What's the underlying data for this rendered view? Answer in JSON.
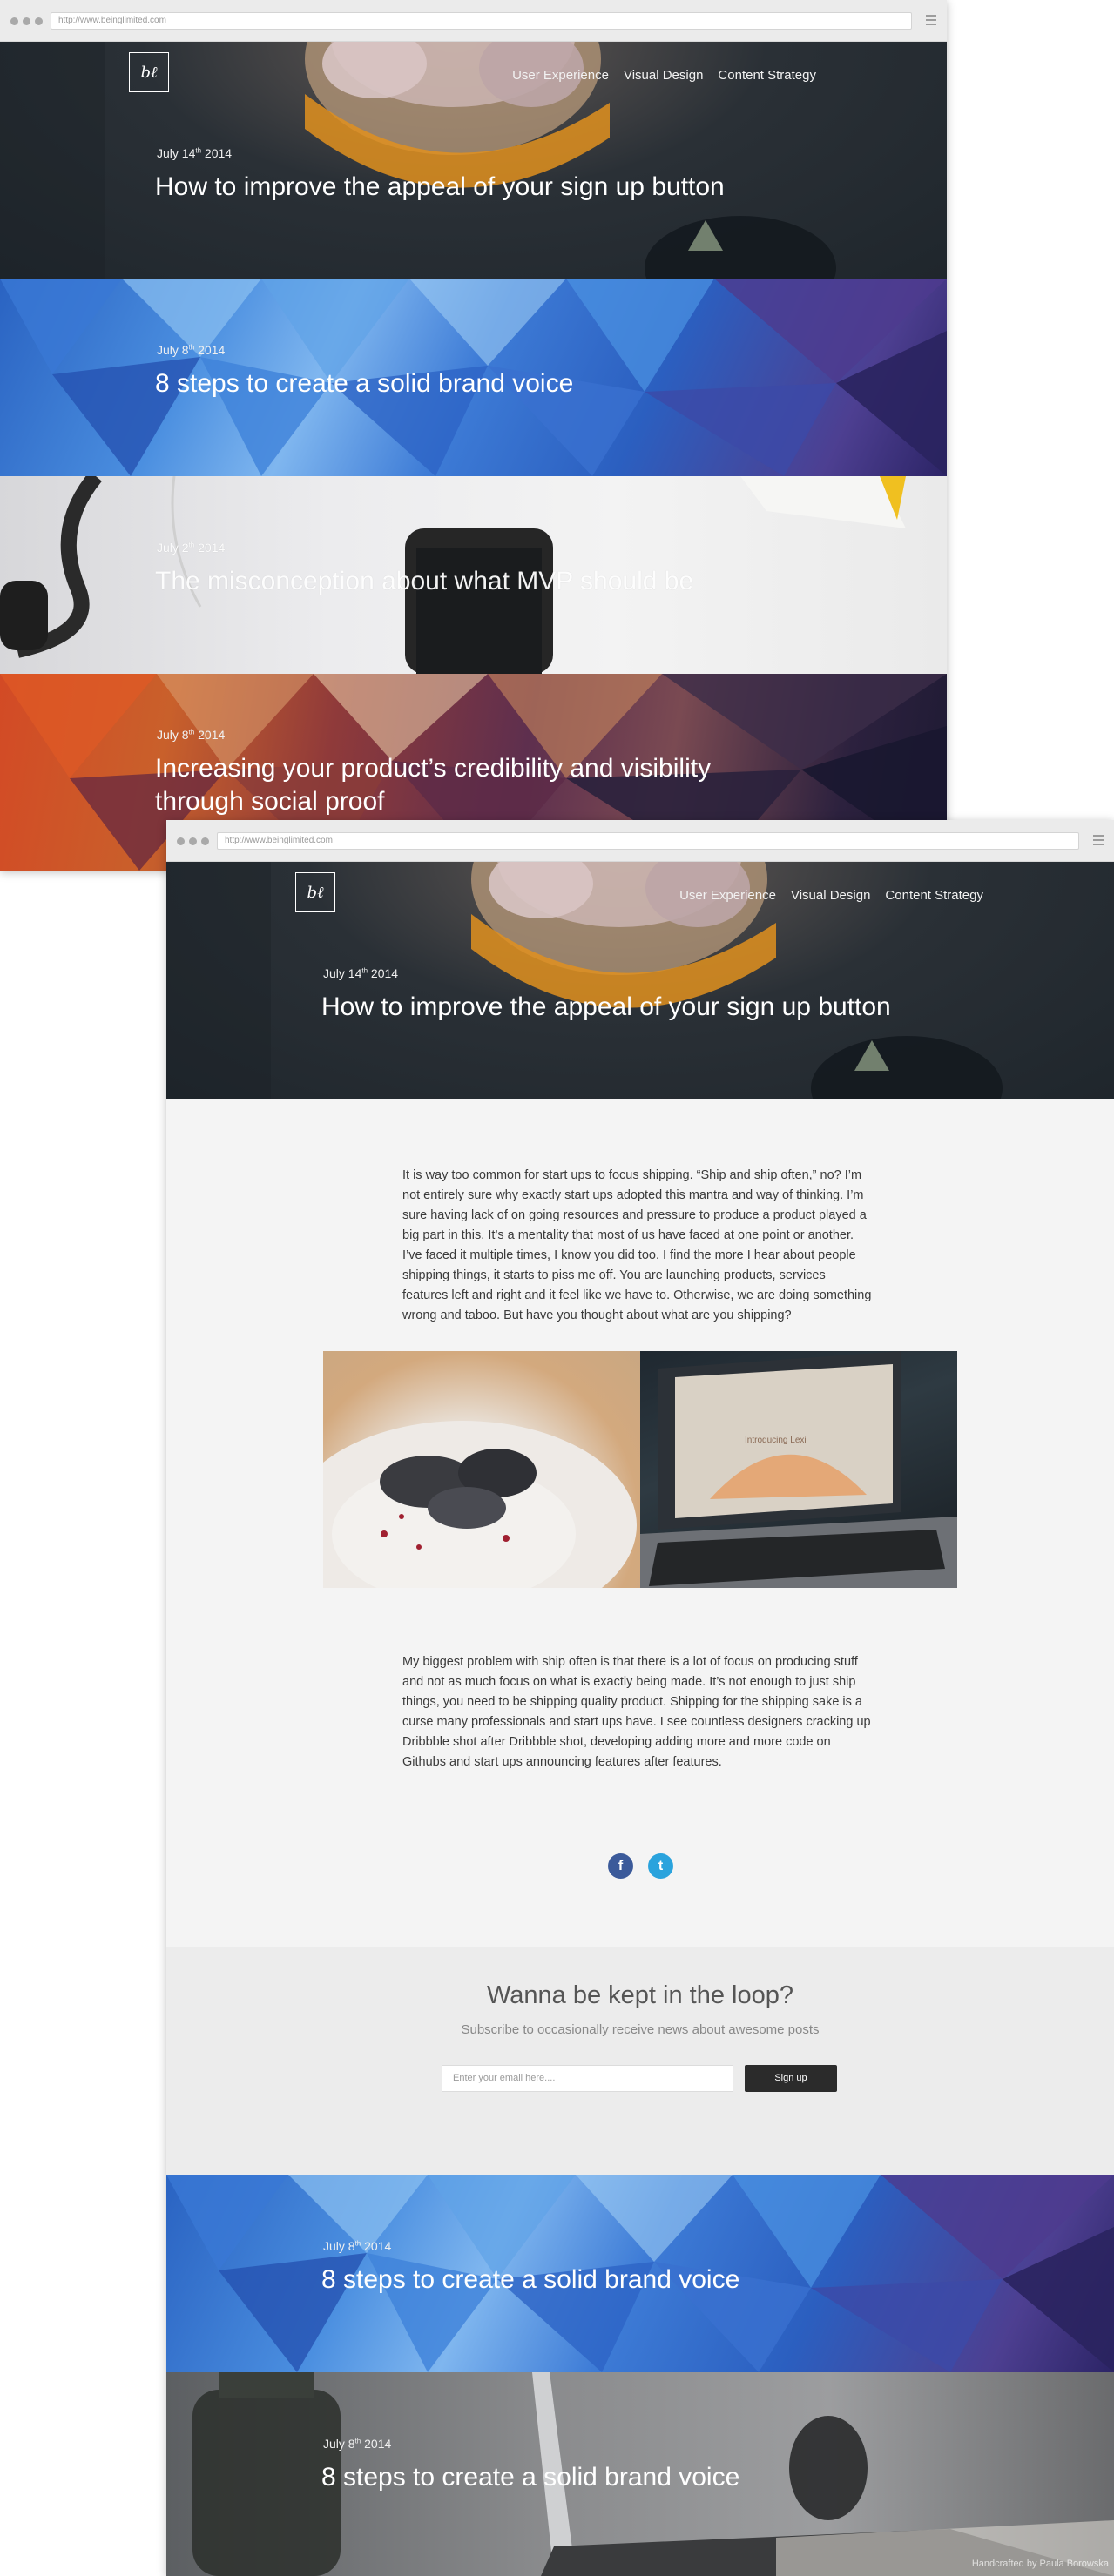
{
  "browser": {
    "url": "http://www.beinglimited.com"
  },
  "site": {
    "logo_text": "bℓ",
    "nav": [
      "User Experience",
      "Visual Design",
      "Content Strategy"
    ]
  },
  "list_page": {
    "posts": [
      {
        "date_day": "July 14",
        "date_suffix": "th",
        "date_year": " 2014",
        "title": "How to improve the appeal of your sign up button"
      },
      {
        "date_day": "July 8",
        "date_suffix": "th",
        "date_year": " 2014",
        "title": "8 steps to create a solid brand voice"
      },
      {
        "date_day": "July 2",
        "date_suffix": "th",
        "date_year": " 2014",
        "title": "The misconception about what MVP should be"
      },
      {
        "date_day": "July 8",
        "date_suffix": "th",
        "date_year": " 2014",
        "title_line1": "Increasing your product’s credibility and visibility",
        "title_line2": "through social proof"
      }
    ]
  },
  "article_page": {
    "hero": {
      "date_day": "July 14",
      "date_suffix": "th",
      "date_year": " 2014",
      "title": "How to improve the appeal of your sign up button"
    },
    "paragraph1": "It is way too common for start ups to focus shipping. “Ship and ship often,” no? I’m not entirely sure why exactly start ups adopted this mantra and way of thinking. I’m sure having lack of on going resources and pressure to produce a product played a big part in this. It’s a mentality that most of us have faced at one point or another. I’ve faced it multiple times, I know you did too. I find the more I hear about people shipping things, it starts to piss me off. You are launching products, services features left and right and it feel like we have to. Otherwise, we are doing something wrong and taboo. But have you thought about what are you shipping?",
    "paragraph2": "My biggest problem with ship often is that there is a lot of focus on producing stuff and not as much focus on what is exactly being made. It’s not enough to just ship things, you need to be shipping quality product. Shipping for the shipping sake is a curse many professionals and start ups have. I see countless designers cracking up Dribbble shot after Dribbble shot, developing adding more and more code on Githubs and start ups announcing features after features.",
    "screen_text": "Introducing Lexi",
    "social": {
      "facebook": "f",
      "twitter": "t"
    },
    "newsletter": {
      "title": "Wanna be kept in the loop?",
      "subtitle": "Subscribe to occasionally receive news about awesome posts",
      "placeholder": "Enter your email here....",
      "button": "Sign up"
    },
    "related": [
      {
        "date_day": "July 8",
        "date_suffix": "th",
        "date_year": " 2014",
        "title": "8 steps to create a solid brand voice"
      },
      {
        "date_day": "July 8",
        "date_suffix": "th",
        "date_year": " 2014",
        "title": "8 steps to create a solid brand voice"
      }
    ],
    "credit": "Handcrafted by Paula Borowska"
  },
  "colors": {
    "facebook": "#3b5a9a",
    "twitter": "#2aa3dd",
    "button_dark": "#2b2b2b",
    "article_bg": "#f4f4f4"
  }
}
